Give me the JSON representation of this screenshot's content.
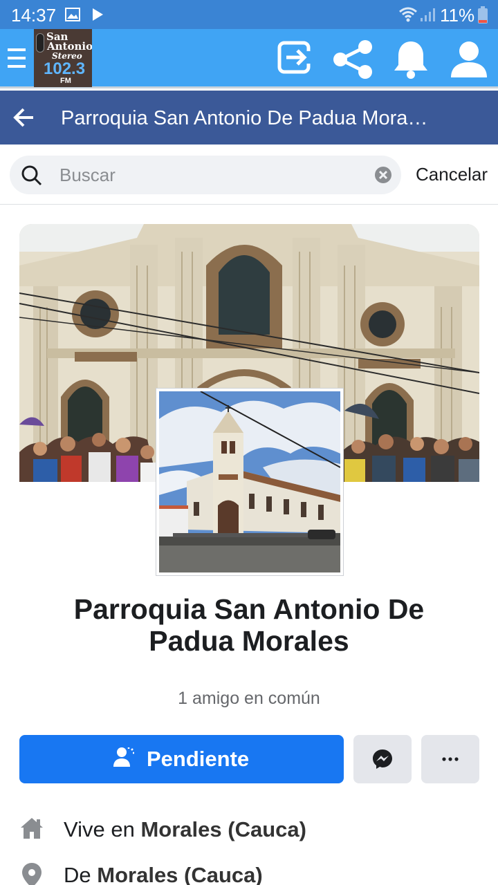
{
  "status_bar": {
    "time": "14:37",
    "battery": "11%"
  },
  "app_bar": {
    "logo": {
      "line1": "San",
      "line2": "Antonio",
      "line3": "Stereo",
      "line4": "102.3",
      "line5": "FM"
    },
    "icons": [
      "menu-icon",
      "exit-icon",
      "share-icon",
      "bell-icon",
      "user-icon"
    ]
  },
  "header": {
    "title": "Parroquia San Antonio De Padua Mora…"
  },
  "search": {
    "placeholder": "Buscar",
    "value": "",
    "cancel_label": "Cancelar"
  },
  "profile": {
    "name": "Parroquia San Antonio De Padua Morales",
    "mutual_friends": "1 amigo en común",
    "primary_button": "Pendiente",
    "info": [
      {
        "icon": "home-icon",
        "prefix": "Vive en",
        "value": "Morales (Cauca)"
      },
      {
        "icon": "location-pin-icon",
        "prefix": "De",
        "value": "Morales (Cauca)"
      }
    ]
  },
  "colors": {
    "status_bar": "#3a84d4",
    "app_bar": "#40a4f4",
    "fb_header": "#3b5998",
    "primary_button": "#1877f2"
  }
}
